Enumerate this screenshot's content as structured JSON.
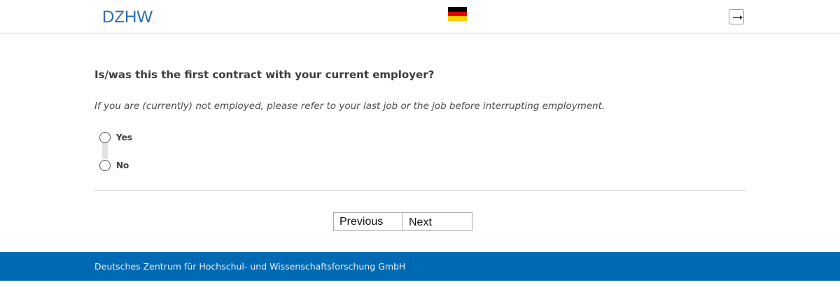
{
  "header": {
    "logo_text": "DZHW",
    "logo_dot": ".",
    "language_flag": "german-flag-icon",
    "logout_icon": "logout-icon"
  },
  "question": {
    "title": "Is/was this the first contract with your current employer?",
    "instruction": "If you are (currently) not employed, please refer to your last job or the job before interrupting employment.",
    "options": [
      {
        "label": "Yes",
        "selected": false
      },
      {
        "label": "No",
        "selected": false
      }
    ]
  },
  "navigation": {
    "previous_label": "Previous",
    "next_label": "Next"
  },
  "footer": {
    "text": "Deutsches Zentrum für Hochschul- und Wissenschaftsforschung GmbH"
  },
  "colors": {
    "brand_blue": "#0069b4",
    "logo_blue": "#2b6cb0"
  }
}
